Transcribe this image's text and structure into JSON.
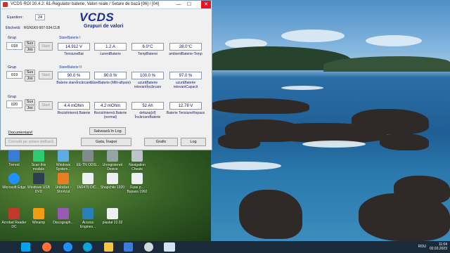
{
  "window": {
    "title": "VCDS ROI 20.4.2: 61-Regulator baterie,  Valori reale / Setare de bază [06] / [04]",
    "minimize": "—",
    "maximize": "☐",
    "close": "✕"
  },
  "header": {
    "esantion_label": "Eșantion:",
    "esantion_value": "24",
    "eticheta_label": "Etichetă:",
    "eticheta_value": "RGN1K0-907-534.CLB",
    "app_name": "VCDS",
    "subtitle": "Grupuri de valori"
  },
  "groups": [
    {
      "label": "Grup",
      "number": "018",
      "up": "Sus",
      "down": "Jos",
      "start": "Start",
      "title": "StareBaterie I",
      "values": [
        "14.912 V",
        "1.2 A",
        "6.0°C",
        "28.0°C"
      ],
      "captions": [
        "TensiuneBat",
        "curentBaterie",
        "TempBaterei",
        "ambientBaterie-Temp"
      ]
    },
    {
      "label": "Grup",
      "number": "019",
      "up": "Sus",
      "down": "Jos",
      "start": "Start",
      "title": "StareBaterie II",
      "values": [
        "90.0 %",
        "90.0 %",
        "100.0 %",
        "97.0 %"
      ],
      "captions": [
        "Baterie stareÎncărcare",
        "StareBaterie (Milli-afișare)",
        "uzurăBaterie relevantÎncărcare",
        "uzurăBaterie relevantCapacit"
      ]
    },
    {
      "label": "Grup",
      "number": "020",
      "up": "Sus",
      "down": "Jos",
      "start": "Start",
      "title": "",
      "values": [
        "4.4 mOhm",
        "4.2 mOhm",
        "52 Ah",
        "12.78 V"
      ],
      "captions": [
        "RezistInternă Baterie",
        "RezistInternă Baterie (normal)",
        "defazaj(sf) ÎncărcareBaterie",
        "Baterie TensiuneRepaos"
      ]
    }
  ],
  "footer": {
    "documentation": "Documentare!",
    "switch_basic": "Comută pe setare deBază",
    "log_save": "Salvează în Log",
    "done": "Gata, Înapoi",
    "graph": "Grafic",
    "log": "Log"
  },
  "desktop_icons": [
    {
      "label": "Torrent",
      "color": "#3a7bd5"
    },
    {
      "label": "Scan this module",
      "color": "#2ecc71"
    },
    {
      "label": "Windows System...",
      "color": "#5dade2"
    },
    {
      "label": "EE-TN ODIS...",
      "color": "#7f8c8d"
    },
    {
      "label": "Unregistered Device",
      "color": "#95a5a6"
    },
    {
      "label": "Navigation Cheats",
      "color": "#bdc3c7"
    },
    {
      "label": "Microsoft Edge",
      "color": "#1e90ff"
    },
    {
      "label": "Windows USB DVD",
      "color": "#2c3e50"
    },
    {
      "label": "Unlocker - Shortcut",
      "color": "#e67e22"
    },
    {
      "label": "1N0479 DIC...",
      "color": "#ecf0f1"
    },
    {
      "label": "Shapchiki 1920",
      "color": "#ecf0f1"
    },
    {
      "label": "Fuse p... Bypass 1992",
      "color": "#ecf0f1"
    },
    {
      "label": "Acrobat Reader DC",
      "color": "#c0392b"
    },
    {
      "label": "Winamp",
      "color": "#f39c12"
    },
    {
      "label": "Discograph...",
      "color": "#9b59b6"
    },
    {
      "label": "Access Engines...",
      "color": "#2980b9"
    },
    {
      "label": "piastat 22.02",
      "color": "#ecf0f1"
    }
  ],
  "taskbar": {
    "language": "ROU",
    "time": "11:04",
    "date": "02.03.2023"
  },
  "colors": {
    "title_blue": "#1a2f9a",
    "close_red": "#e81123"
  }
}
